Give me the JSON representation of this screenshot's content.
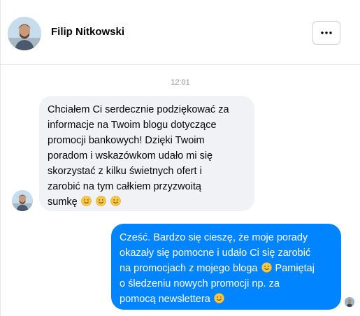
{
  "contact": {
    "name": "Filip Nitkowski",
    "avatar_icon": "profile-photo-icon"
  },
  "header": {
    "more_icon": "more-horizontal-icon"
  },
  "conversation": {
    "timestamp": "12:01",
    "messages": [
      {
        "direction": "incoming",
        "lines": [
          "Chciałem Ci serdecznie podziękować za",
          "informacje na Twoim blogu dotyczące",
          "promocji bankowych! Dzięki Twoim",
          "poradom i wskazówkom udało mi się",
          "skorzystać z kilku świetnych ofert i",
          "zarobić na tym całkiem przyzwoitą",
          "sumkę"
        ],
        "trailing_emoji": [
          "smile-emoji",
          "smile-emoji",
          "smile-emoji"
        ]
      },
      {
        "direction": "outgoing",
        "lines": [
          "Cześć. Bardzo się cieszę, że moje porady",
          "okazały się pomocne i udało Ci się zarobić",
          "na promocjach z mojego bloga",
          "Pamiętaj",
          "o śledzeniu nowych promocji np. za",
          "pomocą newslettera"
        ]
      }
    ]
  },
  "colors": {
    "outgoing_bubble": "#0084ff",
    "incoming_bubble": "#f0f2f5",
    "emoji": "#f7c844"
  }
}
